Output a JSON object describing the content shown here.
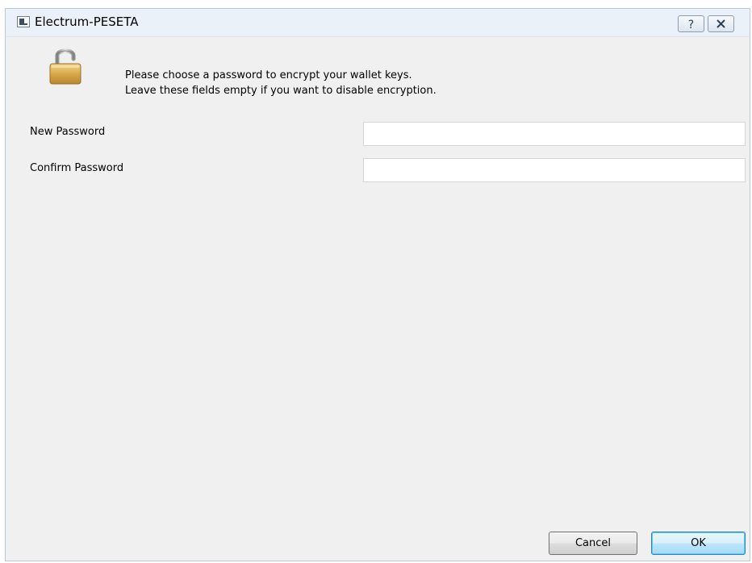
{
  "window": {
    "title": "Electrum-PESETA",
    "help_icon": "question-mark-icon",
    "close_icon": "close-x-icon"
  },
  "dialog": {
    "icon": "padlock-open-icon",
    "intro_line_1": "Please choose a password to encrypt your wallet keys.",
    "intro_line_2": "Leave these fields empty if you want to disable encryption.",
    "new_password_label": "New Password",
    "new_password_value": "",
    "confirm_password_label": "Confirm Password",
    "confirm_password_value": ""
  },
  "buttons": {
    "cancel_label": "Cancel",
    "ok_label": "OK"
  },
  "colors": {
    "dialog_background": "#f0f0f0",
    "titlebar_background": "#eaf1f9",
    "ok_button_border": "#3c7fb1"
  }
}
